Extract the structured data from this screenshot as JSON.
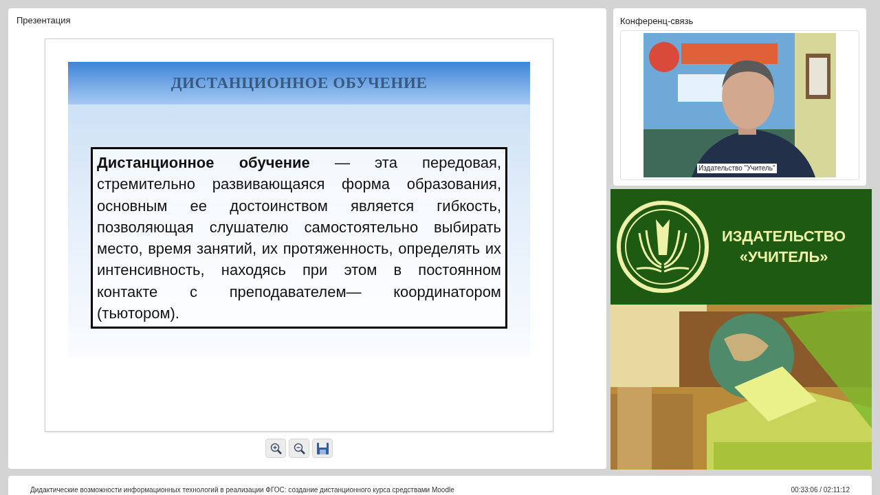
{
  "presentation": {
    "title": "Презентация",
    "slide": {
      "heading": "ДИСТАНЦИОННОЕ ОБУЧЕНИЕ",
      "text": "**Дистанционное обучение** — эта передовая, стремительно развивающаяся форма образования, основным ее достоинством является гибкость, позволяющая слушателю самостоятельно выбирать место, время занятий, их протяженность, определять их интенсивность, находясь при этом в постоянном контакте с преподавателем— координатором (тьютором)."
    },
    "toolbar": [
      {
        "kind": "zoom-in"
      },
      {
        "kind": "zoom-out"
      },
      {
        "kind": "save"
      }
    ]
  },
  "conference": {
    "title": "Конференц-связь",
    "speaker_label": "Издательство \"Учитель\""
  },
  "banner": {
    "lines": [
      "ИЗДАТЕЛЬСТВО",
      "«УЧИТЕЛЬ»"
    ]
  },
  "footer": {
    "title": "Дидактические возможности информационных технологий в реализации ФГОС: создание дистанционного курса средствами Moodle",
    "time": "00:33:06 / 02:11:12"
  }
}
